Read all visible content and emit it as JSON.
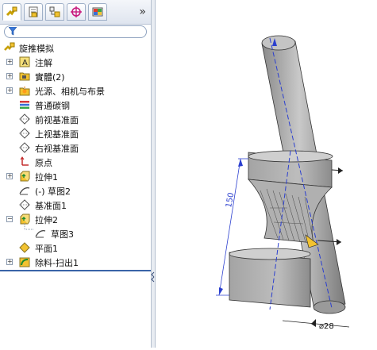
{
  "tabs": [
    {
      "icon": "feature-manager-icon"
    },
    {
      "icon": "property-manager-icon"
    },
    {
      "icon": "configuration-manager-icon"
    },
    {
      "icon": "dimxpert-icon"
    },
    {
      "icon": "display-manager-icon"
    }
  ],
  "more_label": "»",
  "tree": {
    "root": "旋推模拟",
    "items": [
      {
        "label": "注解"
      },
      {
        "label": "實體(2)"
      },
      {
        "label": "光源、相机与布景"
      },
      {
        "label": "普通碳钢"
      },
      {
        "label": "前视基准面"
      },
      {
        "label": "上视基准面"
      },
      {
        "label": "右视基准面"
      },
      {
        "label": "原点"
      },
      {
        "label": "拉伸1"
      },
      {
        "label": "(-) 草图2"
      },
      {
        "label": "基准面1"
      },
      {
        "label": "拉伸2"
      },
      {
        "label": "草图3"
      },
      {
        "label": "平面1"
      },
      {
        "label": "除料-扫出1"
      }
    ]
  },
  "viewport": {
    "dim_height": "150",
    "dim_diameter": "⌀28"
  },
  "colors": {
    "accent": "#3a64a8",
    "model": "#b4b4b4",
    "dim_line": "#2b3fcf"
  }
}
